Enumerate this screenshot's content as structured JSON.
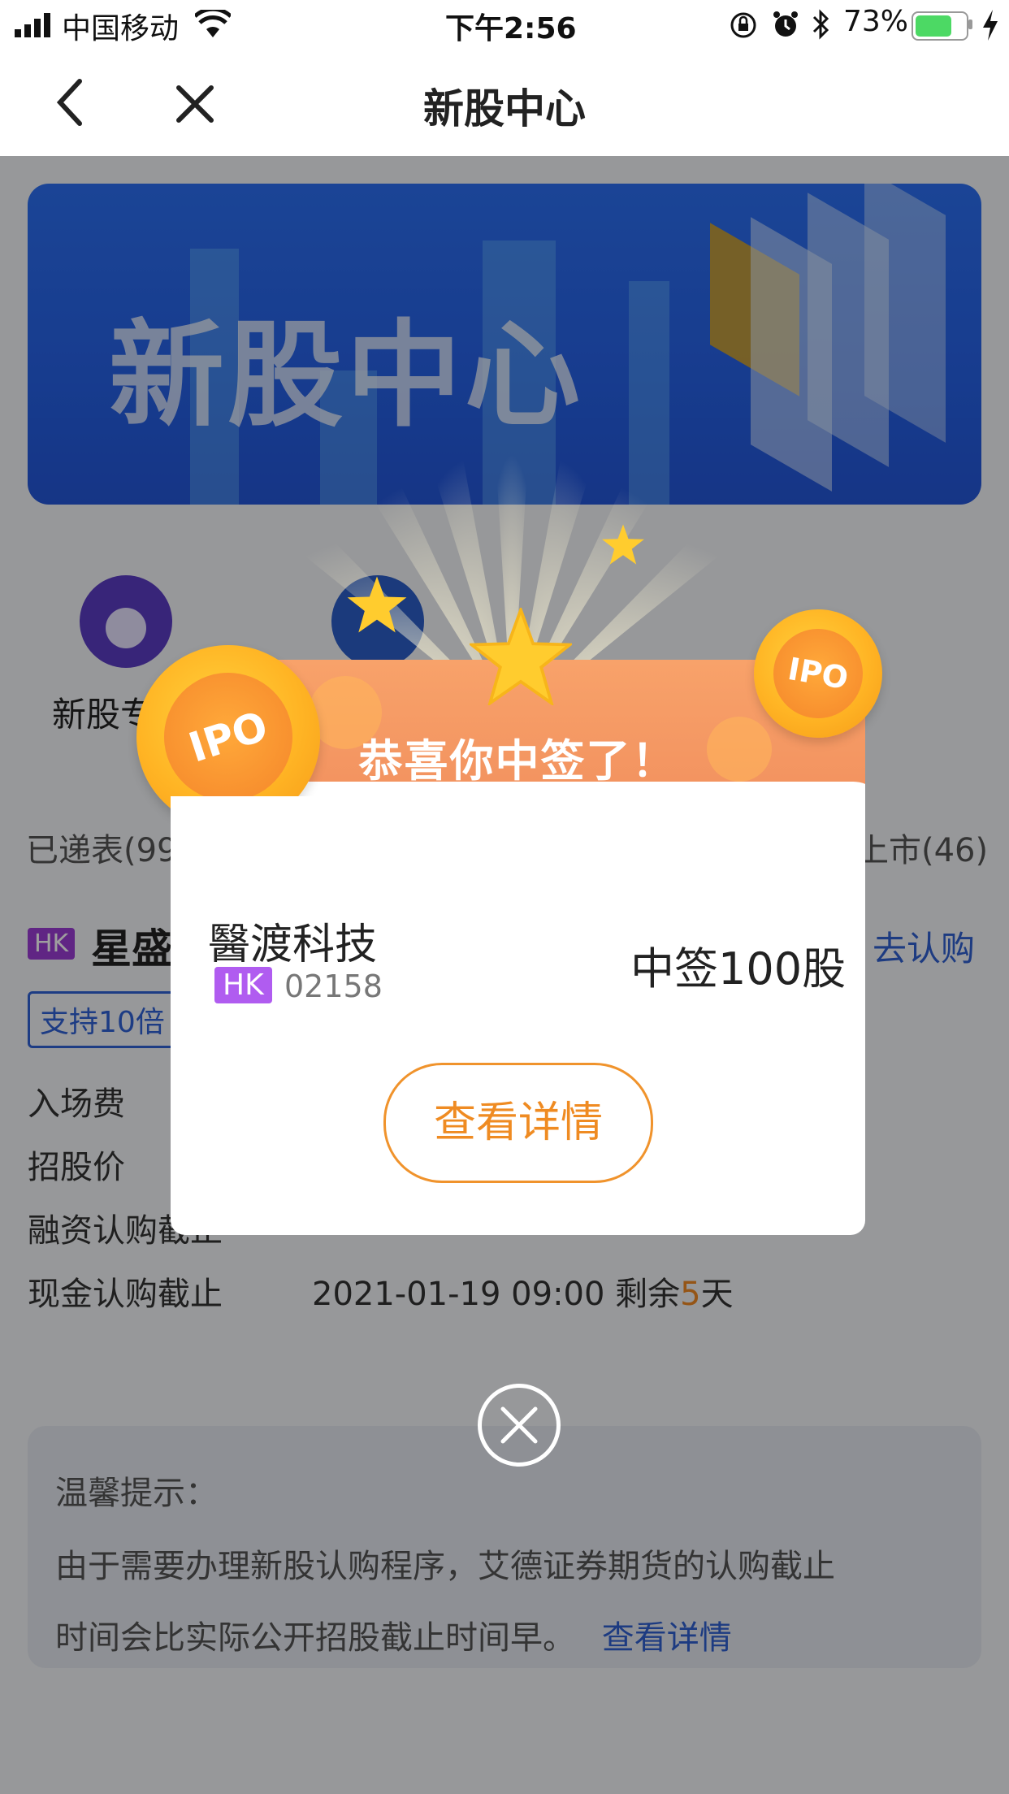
{
  "status_bar": {
    "carrier": "中国移动",
    "time": "下午2:56",
    "battery_percent": "73%",
    "battery_level": 0.73,
    "icons": [
      "signal-icon",
      "wifi-icon",
      "orientation-lock-icon",
      "alarm-icon",
      "bluetooth-icon",
      "battery-icon",
      "charging-icon"
    ]
  },
  "nav": {
    "title": "新股中心",
    "back_icon": "chevron-left-icon",
    "close_icon": "close-icon"
  },
  "banner": {
    "title": "新股中心"
  },
  "features": [
    {
      "label": "新股专",
      "icon": "star-person-icon",
      "color": "#5b3cc4"
    },
    {
      "label": "",
      "icon": "star-badge-icon",
      "color": "#2c5ec8"
    }
  ],
  "tabs": {
    "left": "已递表(99",
    "right": "上市(46)"
  },
  "ipo_item": {
    "market": "HK",
    "name": "星盛",
    "action": "去认购",
    "tag": "支持10倍",
    "rows": [
      {
        "label": "入场费",
        "value": ""
      },
      {
        "label": "招股价",
        "value": ""
      },
      {
        "label": "融资认购截止",
        "value": ""
      },
      {
        "label": "现金认购截止",
        "value_prefix": "2021-01-19 09:00 剩余",
        "days": "5",
        "value_suffix": "天"
      }
    ]
  },
  "tip": {
    "title": "温馨提示：",
    "text_line1": "由于需要办理新股认购程序，艾德证券期货的认购截止",
    "text_line2": "时间会比实际公开招股截止时间早。",
    "link": "查看详情"
  },
  "popup": {
    "title": "恭喜你中签了！",
    "coin_text": "IPO",
    "stock_name": "醫渡科技",
    "market": "HK",
    "stock_code": "02158",
    "result": "中签100股",
    "detail_button": "查看详情",
    "colors": {
      "header": "#f39a61",
      "accent": "#ef8b22",
      "badge": "#b05cf0"
    }
  }
}
